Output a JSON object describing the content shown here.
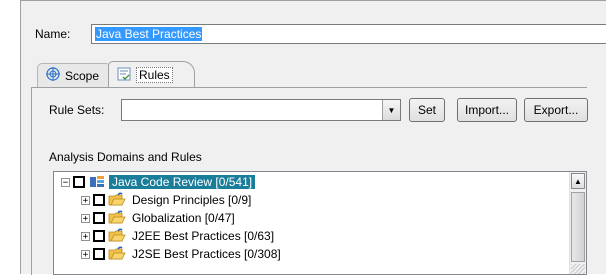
{
  "form": {
    "name_label": "Name:",
    "name_value": "Java Best Practices"
  },
  "tabs": [
    {
      "label": "Scope",
      "icon": "target-icon",
      "selected": false
    },
    {
      "label": "Rules",
      "icon": "rules-icon",
      "selected": true
    }
  ],
  "rules": {
    "rule_sets_label": "Rule Sets:",
    "rule_sets_value": "",
    "set_button": "Set",
    "import_button": "Import...",
    "export_button": "Export...",
    "domains_label": "Analysis Domains and Rules"
  },
  "tree": {
    "items": [
      {
        "label": "Java Code Review [0/541]",
        "icon": "code-review-icon",
        "level": 0,
        "selected": true,
        "expanded": true,
        "checked": false
      },
      {
        "label": "Design Principles [0/9]",
        "icon": "folder-icon",
        "level": 1,
        "selected": false,
        "expanded": false,
        "checked": false
      },
      {
        "label": "Globalization [0/47]",
        "icon": "folder-icon",
        "level": 1,
        "selected": false,
        "expanded": false,
        "checked": false
      },
      {
        "label": "J2EE Best Practices [0/63]",
        "icon": "folder-icon",
        "level": 1,
        "selected": false,
        "expanded": false,
        "checked": false
      },
      {
        "label": "J2SE Best Practices [0/308]",
        "icon": "folder-icon",
        "level": 1,
        "selected": false,
        "expanded": false,
        "checked": false
      }
    ]
  },
  "colors": {
    "selection": "#1a7d9a",
    "text_selection": "#3399ff",
    "panel_bg": "#f0f0f0"
  }
}
